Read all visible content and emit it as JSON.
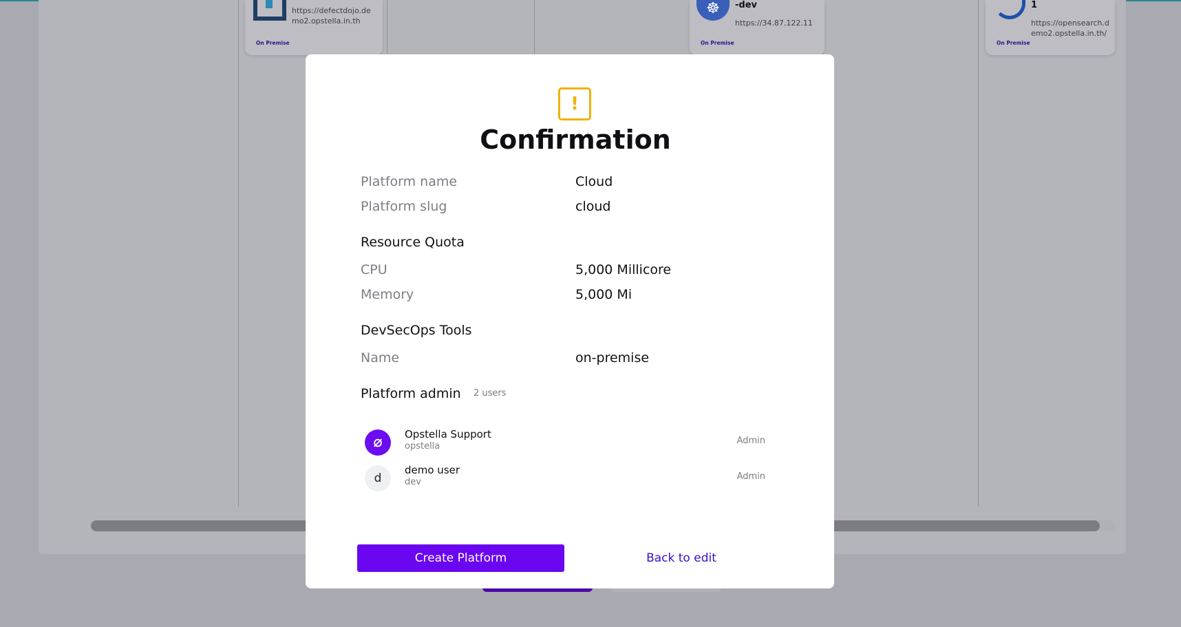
{
  "background": {
    "cards": [
      {
        "name": "",
        "url": "https://defectdojo.demo2.opstella.in.th",
        "url_line1": "https://defectdojo.de",
        "url_line2": "mo2.opstella.in.th",
        "tag": "On Premise",
        "logo": "defectdojo-logo"
      },
      {
        "name": "-dev",
        "url_line1": "https://34.87.122.11",
        "url_line2": "",
        "tag": "On Premise",
        "logo": "kubernetes-logo"
      },
      {
        "name": "1",
        "url_line1": "https://opensearch.d",
        "url_line2": "emo2.opstella.in.th/",
        "tag": "On Premise",
        "logo": "opensearch-logo"
      }
    ]
  },
  "modal": {
    "icon": "warning-icon",
    "icon_glyph": "!",
    "title": "Confirmation",
    "platform_name_label": "Platform name",
    "platform_name_value": "Cloud",
    "platform_slug_label": "Platform slug",
    "platform_slug_value": "cloud",
    "resource_quota_heading": "Resource Quota",
    "cpu_label": "CPU",
    "cpu_value": "5,000 Millicore",
    "memory_label": "Memory",
    "memory_value": "5,000 Mi",
    "devsecops_heading": "DevSecOps Tools",
    "tool_name_label": "Name",
    "tool_name_value": "on-premise",
    "platform_admin_heading": "Platform admin",
    "admin_count": "2 users",
    "admins": [
      {
        "name": "Opstella Support",
        "handle": "opstella",
        "role": "Admin",
        "avatar": "opstella-logo-icon",
        "avatar_glyph": "⌀"
      },
      {
        "name": "demo user",
        "handle": "dev",
        "role": "Admin",
        "avatar": "letter-avatar",
        "avatar_glyph": "d"
      }
    ],
    "create_button": "Create Platform",
    "back_button": "Back to edit"
  },
  "colors": {
    "accent": "#6a06f0",
    "warning": "#f0b10a",
    "link": "#3b0fc9",
    "overlay": "#a9a9b2"
  }
}
